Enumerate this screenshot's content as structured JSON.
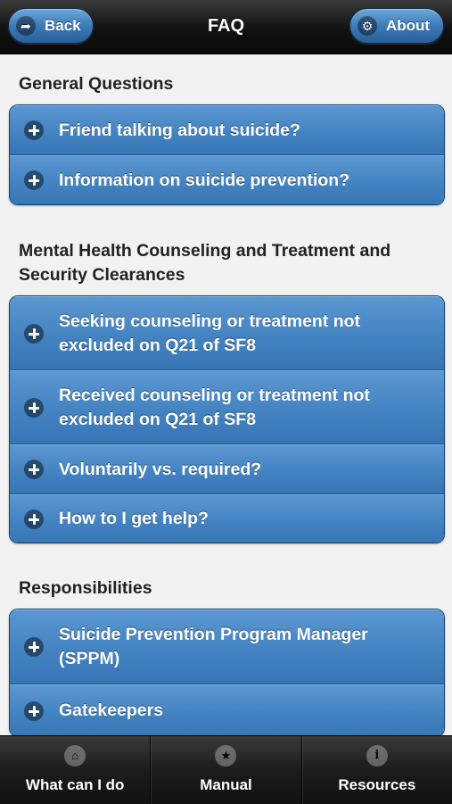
{
  "header": {
    "title": "FAQ",
    "back_label": "Back",
    "about_label": "About"
  },
  "sections": [
    {
      "title": "General Questions",
      "items": [
        {
          "label": "Friend talking about suicide?"
        },
        {
          "label": "Information on suicide prevention?"
        }
      ]
    },
    {
      "title": "Mental Health Counseling and Treatment and Security Clearances",
      "items": [
        {
          "label": "Seeking counseling or treatment not excluded on Q21 of SF8"
        },
        {
          "label": "Received counseling or treatment not excluded on Q21 of SF8"
        },
        {
          "label": "Voluntarily vs. required?"
        },
        {
          "label": "How to I get help?"
        }
      ]
    },
    {
      "title": "Responsibilities",
      "items": [
        {
          "label": "Suicide Prevention Program Manager (SPPM)"
        },
        {
          "label": "Gatekeepers"
        }
      ]
    }
  ],
  "footer": {
    "tabs": [
      {
        "label": "What can I do",
        "icon": "home-icon"
      },
      {
        "label": "Manual",
        "icon": "star-icon"
      },
      {
        "label": "Resources",
        "icon": "info-icon"
      }
    ]
  },
  "colors": {
    "row_blue": "#4483c2",
    "header_dark": "#111111",
    "button_blue": "#3c7ab8"
  }
}
